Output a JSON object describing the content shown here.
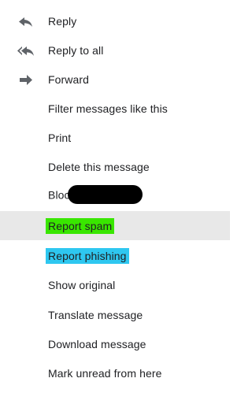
{
  "menu": {
    "items": [
      {
        "label": "Reply",
        "icon": "reply-icon"
      },
      {
        "label": "Reply to all",
        "icon": "reply-all-icon"
      },
      {
        "label": "Forward",
        "icon": "forward-icon"
      },
      {
        "label": "Filter messages like this"
      },
      {
        "label": "Print"
      },
      {
        "label": "Delete this message"
      },
      {
        "label": "Block"
      },
      {
        "label": "Report spam",
        "highlight_color": "#39e600"
      },
      {
        "label": "Report phishing",
        "highlight_color": "#2ec7f0"
      },
      {
        "label": "Show original"
      },
      {
        "label": "Translate message"
      },
      {
        "label": "Download message"
      },
      {
        "label": "Mark unread from here"
      }
    ],
    "icon_color": "#5f6368",
    "hover_bg": "#e8e8e8"
  }
}
